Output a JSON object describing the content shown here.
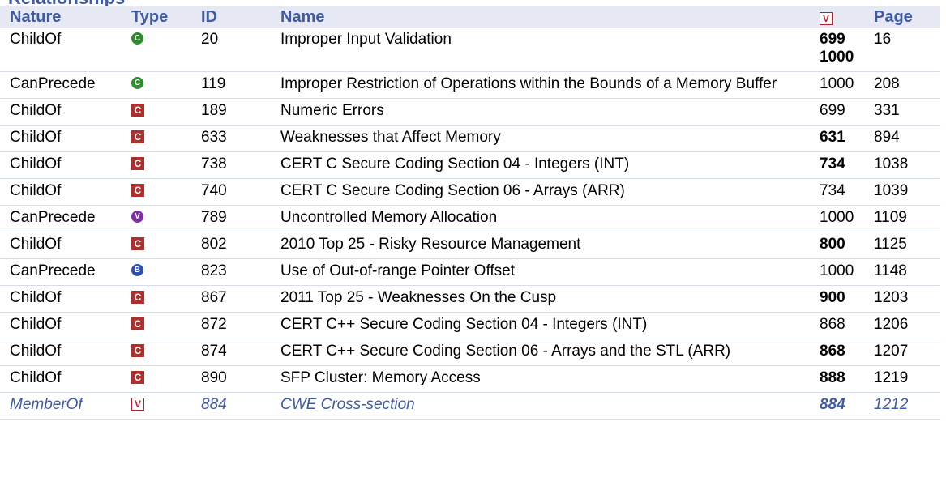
{
  "section_title": "Relationships",
  "header": {
    "nature": "Nature",
    "type": "Type",
    "id": "ID",
    "name": "Name",
    "view_icon": "V",
    "page": "Page"
  },
  "icon_colors": {
    "class": "#2E8B2E",
    "category": "#B02E2E",
    "variant": "#7B2FA0",
    "base": "#2F4FA8",
    "view": "#B52030"
  },
  "rows": [
    {
      "nature": "ChildOf",
      "type": "class",
      "type_glyph": "C",
      "id": "20",
      "name": "Improper Input Validation",
      "views": [
        {
          "v": "699",
          "bold": true
        },
        {
          "v": "1000",
          "bold": true
        }
      ],
      "page": "16"
    },
    {
      "nature": "CanPrecede",
      "type": "class",
      "type_glyph": "C",
      "id": "119",
      "name": "Improper Restriction of Operations within the Bounds of a Memory Buffer",
      "views": [
        {
          "v": "1000",
          "bold": false
        }
      ],
      "page": "208"
    },
    {
      "nature": "ChildOf",
      "type": "category",
      "type_glyph": "C",
      "id": "189",
      "name": "Numeric Errors",
      "views": [
        {
          "v": "699",
          "bold": false
        }
      ],
      "page": "331"
    },
    {
      "nature": "ChildOf",
      "type": "category",
      "type_glyph": "C",
      "id": "633",
      "name": "Weaknesses that Affect Memory",
      "views": [
        {
          "v": "631",
          "bold": true
        }
      ],
      "page": "894"
    },
    {
      "nature": "ChildOf",
      "type": "category",
      "type_glyph": "C",
      "id": "738",
      "name": "CERT C Secure Coding Section 04 - Integers (INT)",
      "views": [
        {
          "v": "734",
          "bold": true
        }
      ],
      "page": "1038"
    },
    {
      "nature": "ChildOf",
      "type": "category",
      "type_glyph": "C",
      "id": "740",
      "name": "CERT C Secure Coding Section 06 - Arrays (ARR)",
      "views": [
        {
          "v": "734",
          "bold": false
        }
      ],
      "page": "1039"
    },
    {
      "nature": "CanPrecede",
      "type": "variant",
      "type_glyph": "V",
      "id": "789",
      "name": "Uncontrolled Memory Allocation",
      "views": [
        {
          "v": "1000",
          "bold": false
        }
      ],
      "page": "1109"
    },
    {
      "nature": "ChildOf",
      "type": "category",
      "type_glyph": "C",
      "id": "802",
      "name": "2010 Top 25 - Risky Resource Management",
      "views": [
        {
          "v": "800",
          "bold": true
        }
      ],
      "page": "1125"
    },
    {
      "nature": "CanPrecede",
      "type": "base",
      "type_glyph": "B",
      "id": "823",
      "name": "Use of Out-of-range Pointer Offset",
      "views": [
        {
          "v": "1000",
          "bold": false
        }
      ],
      "page": "1148"
    },
    {
      "nature": "ChildOf",
      "type": "category",
      "type_glyph": "C",
      "id": "867",
      "name": "2011 Top 25 - Weaknesses On the Cusp",
      "views": [
        {
          "v": "900",
          "bold": true
        }
      ],
      "page": "1203"
    },
    {
      "nature": "ChildOf",
      "type": "category",
      "type_glyph": "C",
      "id": "872",
      "name": "CERT C++ Secure Coding Section 04 - Integers (INT)",
      "views": [
        {
          "v": "868",
          "bold": false
        }
      ],
      "page": "1206"
    },
    {
      "nature": "ChildOf",
      "type": "category",
      "type_glyph": "C",
      "id": "874",
      "name": "CERT C++ Secure Coding Section 06 - Arrays and the STL (ARR)",
      "views": [
        {
          "v": "868",
          "bold": true
        }
      ],
      "page": "1207"
    },
    {
      "nature": "ChildOf",
      "type": "category",
      "type_glyph": "C",
      "id": "890",
      "name": "SFP Cluster: Memory Access",
      "views": [
        {
          "v": "888",
          "bold": true
        }
      ],
      "page": "1219"
    },
    {
      "nature": "MemberOf",
      "type": "view",
      "type_glyph": "V",
      "id": "884",
      "name": "CWE Cross-section",
      "views": [
        {
          "v": "884",
          "bold": true
        }
      ],
      "page": "1212",
      "member": true
    }
  ]
}
